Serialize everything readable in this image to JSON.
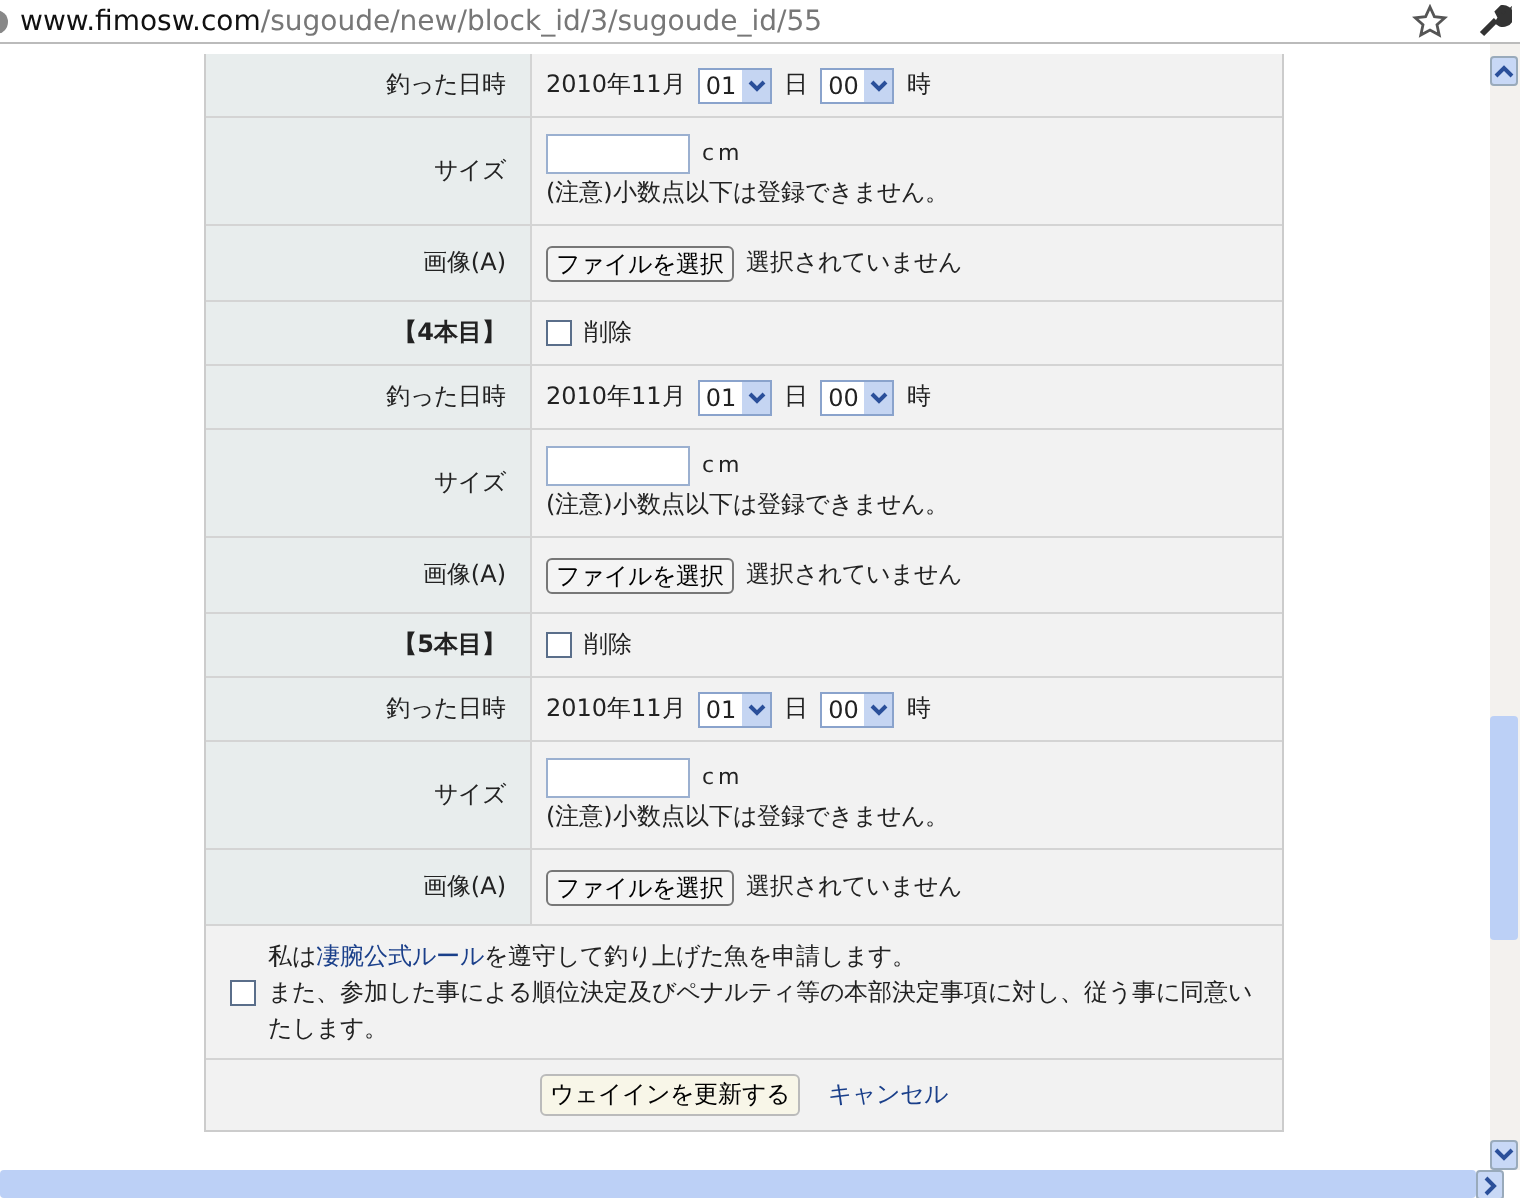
{
  "address_bar": {
    "url_host": "www.fimosw.com",
    "url_path": "/sugoude/new/block_id/3/sugoude_id/55"
  },
  "form_rows": [
    {
      "kind": "datetime",
      "label": "釣った日時",
      "year_month": "2010年11月",
      "day": "01",
      "day_unit": "日",
      "hour": "00",
      "hour_unit": "時"
    },
    {
      "kind": "size",
      "label": "サイズ",
      "value": "",
      "unit": "cm",
      "note": "(注意)小数点以下は登録できません。"
    },
    {
      "kind": "image",
      "label": "画像(A)",
      "button": "ファイルを選択",
      "status": "選択されていません"
    },
    {
      "kind": "entry",
      "label": "【4本目】",
      "delete_label": "削除",
      "checked": false
    },
    {
      "kind": "datetime",
      "label": "釣った日時",
      "year_month": "2010年11月",
      "day": "01",
      "day_unit": "日",
      "hour": "00",
      "hour_unit": "時"
    },
    {
      "kind": "size",
      "label": "サイズ",
      "value": "",
      "unit": "cm",
      "note": "(注意)小数点以下は登録できません。"
    },
    {
      "kind": "image",
      "label": "画像(A)",
      "button": "ファイルを選択",
      "status": "選択されていません"
    },
    {
      "kind": "entry",
      "label": "【5本目】",
      "delete_label": "削除",
      "checked": false
    },
    {
      "kind": "datetime",
      "label": "釣った日時",
      "year_month": "2010年11月",
      "day": "01",
      "day_unit": "日",
      "hour": "00",
      "hour_unit": "時"
    },
    {
      "kind": "size",
      "label": "サイズ",
      "value": "",
      "unit": "cm",
      "note": "(注意)小数点以下は登録できません。"
    },
    {
      "kind": "image",
      "label": "画像(A)",
      "button": "ファイルを選択",
      "status": "選択されていません"
    }
  ],
  "agreement": {
    "checked": false,
    "text_before": "私は",
    "link": "凄腕公式ルール",
    "text_after": "を遵守して釣り上げた魚を申請します。",
    "text_line2": "また、参加した事による順位決定及びペナルティ等の本部決定事項に対し、従う事に同意いたします。"
  },
  "actions": {
    "submit": "ウェイインを更新する",
    "cancel": "キャンセル"
  }
}
